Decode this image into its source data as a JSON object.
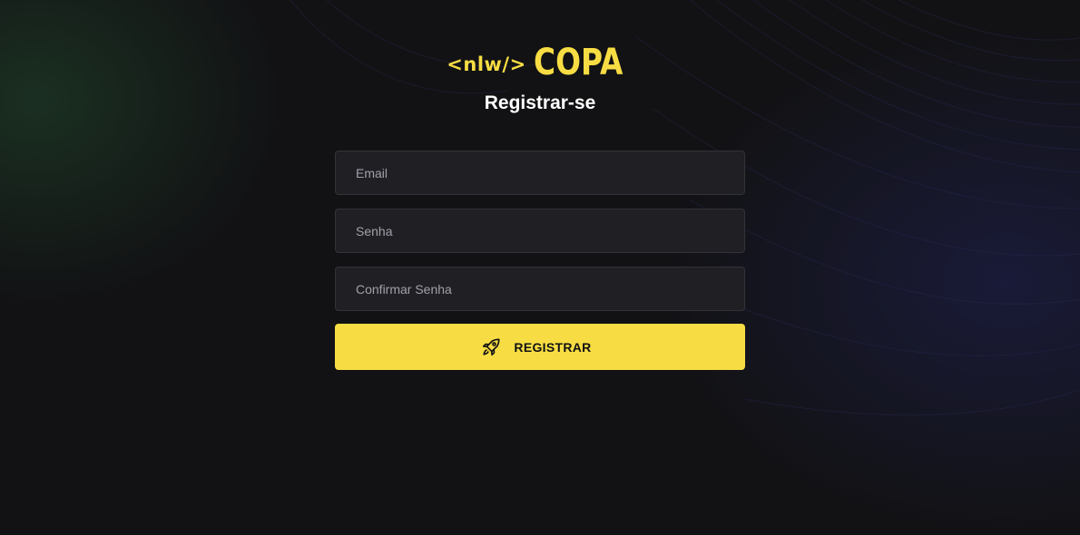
{
  "brand": {
    "tag_text": "<nlw/>",
    "name_text": "COPA",
    "color": "#F7DD43"
  },
  "heading": "Registrar-se",
  "form": {
    "email_placeholder": "Email",
    "password_placeholder": "Senha",
    "confirm_password_placeholder": "Confirmar Senha",
    "submit_label": "REGISTRAR",
    "submit_icon": "rocket-icon"
  },
  "colors": {
    "background": "#121214",
    "field_background": "#202024",
    "field_border": "#323238",
    "accent": "#F7DD43"
  }
}
